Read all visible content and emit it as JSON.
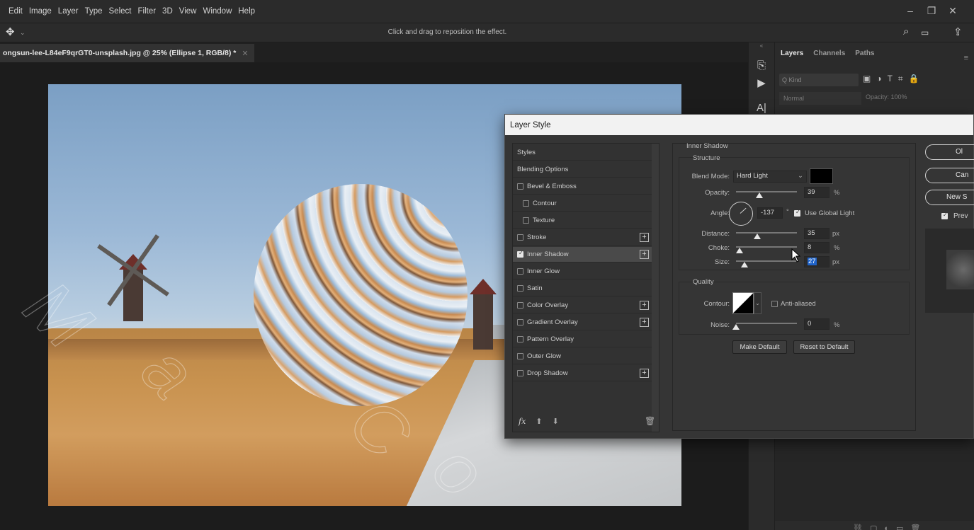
{
  "menubar": {
    "items": [
      "Edit",
      "Image",
      "Layer",
      "Type",
      "Select",
      "Filter",
      "3D",
      "View",
      "Window",
      "Help"
    ]
  },
  "options_bar": {
    "hint": "Click and drag to reposition the effect."
  },
  "document": {
    "tab_title": "ongsun-lee-L84eF9qrGT0-unsplash.jpg @ 25% (Ellipse 1, RGB/8) *"
  },
  "layers_panel": {
    "tabs": [
      "Layers",
      "Channels",
      "Paths"
    ],
    "active_tab": "Layers",
    "kind_placeholder": "Q Kind",
    "blend_mode": "Normal",
    "opacity_label": "Opacity:",
    "opacity_value": "100%"
  },
  "dialog": {
    "title": "Layer Style",
    "style_list": [
      {
        "label": "Styles",
        "checkbox": false,
        "header": true
      },
      {
        "label": "Blending Options",
        "checkbox": false,
        "header": true
      },
      {
        "label": "Bevel & Emboss",
        "checkbox": true,
        "checked": false
      },
      {
        "label": "Contour",
        "checkbox": true,
        "checked": false,
        "indent": true
      },
      {
        "label": "Texture",
        "checkbox": true,
        "checked": false,
        "indent": true
      },
      {
        "label": "Stroke",
        "checkbox": true,
        "checked": false,
        "plus": true
      },
      {
        "label": "Inner Shadow",
        "checkbox": true,
        "checked": true,
        "plus": true,
        "selected": true
      },
      {
        "label": "Inner Glow",
        "checkbox": true,
        "checked": false
      },
      {
        "label": "Satin",
        "checkbox": true,
        "checked": false
      },
      {
        "label": "Color Overlay",
        "checkbox": true,
        "checked": false,
        "plus": true
      },
      {
        "label": "Gradient Overlay",
        "checkbox": true,
        "checked": false,
        "plus": true
      },
      {
        "label": "Pattern Overlay",
        "checkbox": true,
        "checked": false
      },
      {
        "label": "Outer Glow",
        "checkbox": true,
        "checked": false
      },
      {
        "label": "Drop Shadow",
        "checkbox": true,
        "checked": false,
        "plus": true
      }
    ],
    "footer_fx": "fx",
    "section_title": "Inner Shadow",
    "structure": {
      "title": "Structure",
      "blend_mode_label": "Blend Mode:",
      "blend_mode_value": "Hard Light",
      "shadow_color": "#000000",
      "opacity_label": "Opacity:",
      "opacity_value": "39",
      "opacity_unit": "%",
      "angle_label": "Angle:",
      "angle_value": "-137",
      "angle_unit": "°",
      "use_global_light_label": "Use Global Light",
      "use_global_light": true,
      "distance_label": "Distance:",
      "distance_value": "35",
      "distance_unit": "px",
      "choke_label": "Choke:",
      "choke_value": "8",
      "choke_unit": "%",
      "size_label": "Size:",
      "size_value": "27",
      "size_unit": "px"
    },
    "quality": {
      "title": "Quality",
      "contour_label": "Contour:",
      "anti_aliased_label": "Anti-aliased",
      "anti_aliased": false,
      "noise_label": "Noise:",
      "noise_value": "0",
      "noise_unit": "%"
    },
    "buttons": {
      "make_default": "Make Default",
      "reset_default": "Reset to Default",
      "ok": "Ol",
      "cancel": "Can",
      "new_style": "New S",
      "preview": "Prev"
    },
    "preview_checked": true
  }
}
